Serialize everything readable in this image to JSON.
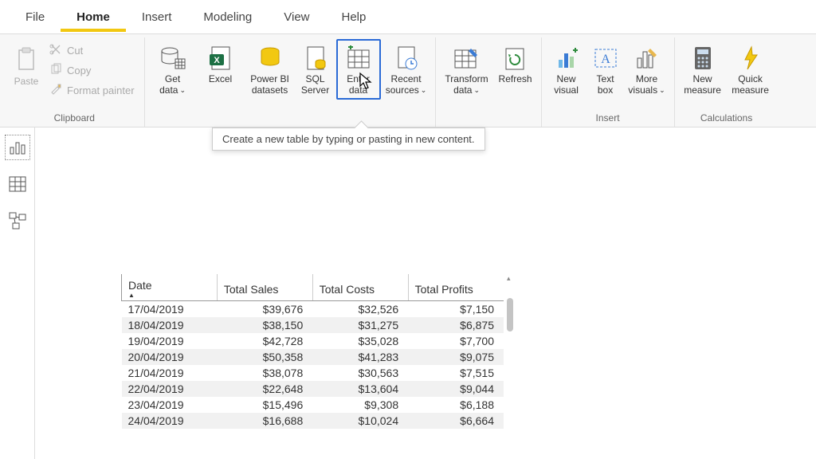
{
  "tabs": [
    "File",
    "Home",
    "Insert",
    "Modeling",
    "View",
    "Help"
  ],
  "activeTab": 1,
  "groups": {
    "clipboard": {
      "label": "Clipboard",
      "paste": "Paste",
      "cut": "Cut",
      "copy": "Copy",
      "format": "Format painter"
    },
    "data": {
      "get": "Get data",
      "excel": "Excel",
      "pbi": "Power BI datasets",
      "sql": "SQL Server",
      "enter": "Enter data",
      "recent": "Recent sources"
    },
    "queries": {
      "transform": "Transform data",
      "refresh": "Refresh"
    },
    "insert": {
      "label": "Insert",
      "newvisual": "New visual",
      "textbox": "Text box",
      "morevisuals": "More visuals"
    },
    "calc": {
      "label": "Calculations",
      "newmeasure": "New measure",
      "quickmeasure": "Quick measure"
    }
  },
  "tooltip": "Create a new table by typing or pasting in new content.",
  "table": {
    "headers": [
      "Date",
      "Total Sales",
      "Total Costs",
      "Total Profits"
    ],
    "rows": [
      [
        "17/04/2019",
        "$39,676",
        "$32,526",
        "$7,150"
      ],
      [
        "18/04/2019",
        "$38,150",
        "$31,275",
        "$6,875"
      ],
      [
        "19/04/2019",
        "$42,728",
        "$35,028",
        "$7,700"
      ],
      [
        "20/04/2019",
        "$50,358",
        "$41,283",
        "$9,075"
      ],
      [
        "21/04/2019",
        "$38,078",
        "$30,563",
        "$7,515"
      ],
      [
        "22/04/2019",
        "$22,648",
        "$13,604",
        "$9,044"
      ],
      [
        "23/04/2019",
        "$15,496",
        "$9,308",
        "$6,188"
      ],
      [
        "24/04/2019",
        "$16,688",
        "$10,024",
        "$6,664"
      ]
    ]
  }
}
